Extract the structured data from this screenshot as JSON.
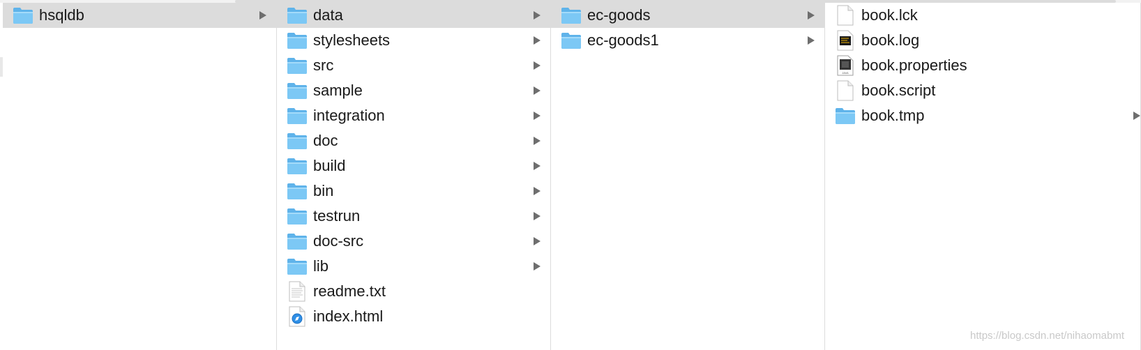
{
  "columns": [
    {
      "items": [
        {
          "name": "hsqldb",
          "type": "folder",
          "selected": true
        }
      ]
    },
    {
      "items": [
        {
          "name": "data",
          "type": "folder",
          "selected": true
        },
        {
          "name": "stylesheets",
          "type": "folder"
        },
        {
          "name": "src",
          "type": "folder"
        },
        {
          "name": "sample",
          "type": "folder"
        },
        {
          "name": "integration",
          "type": "folder"
        },
        {
          "name": "doc",
          "type": "folder"
        },
        {
          "name": "build",
          "type": "folder"
        },
        {
          "name": "bin",
          "type": "folder"
        },
        {
          "name": "testrun",
          "type": "folder"
        },
        {
          "name": "doc-src",
          "type": "folder"
        },
        {
          "name": "lib",
          "type": "folder"
        },
        {
          "name": "readme.txt",
          "type": "text-file"
        },
        {
          "name": "index.html",
          "type": "html-file"
        }
      ]
    },
    {
      "items": [
        {
          "name": "ec-goods",
          "type": "folder",
          "selected": true
        },
        {
          "name": "ec-goods1",
          "type": "folder"
        }
      ]
    },
    {
      "items": [
        {
          "name": "book.lck",
          "type": "blank-file"
        },
        {
          "name": "book.log",
          "type": "log-file"
        },
        {
          "name": "book.properties",
          "type": "java-file"
        },
        {
          "name": "book.script",
          "type": "blank-file"
        },
        {
          "name": "book.tmp",
          "type": "folder"
        }
      ]
    }
  ],
  "watermark": "https://blog.csdn.net/nihaomabmt",
  "colors": {
    "folder": "#7cc8f5",
    "folder_tab": "#5fb3ea",
    "selection": "#dcdcdc"
  }
}
